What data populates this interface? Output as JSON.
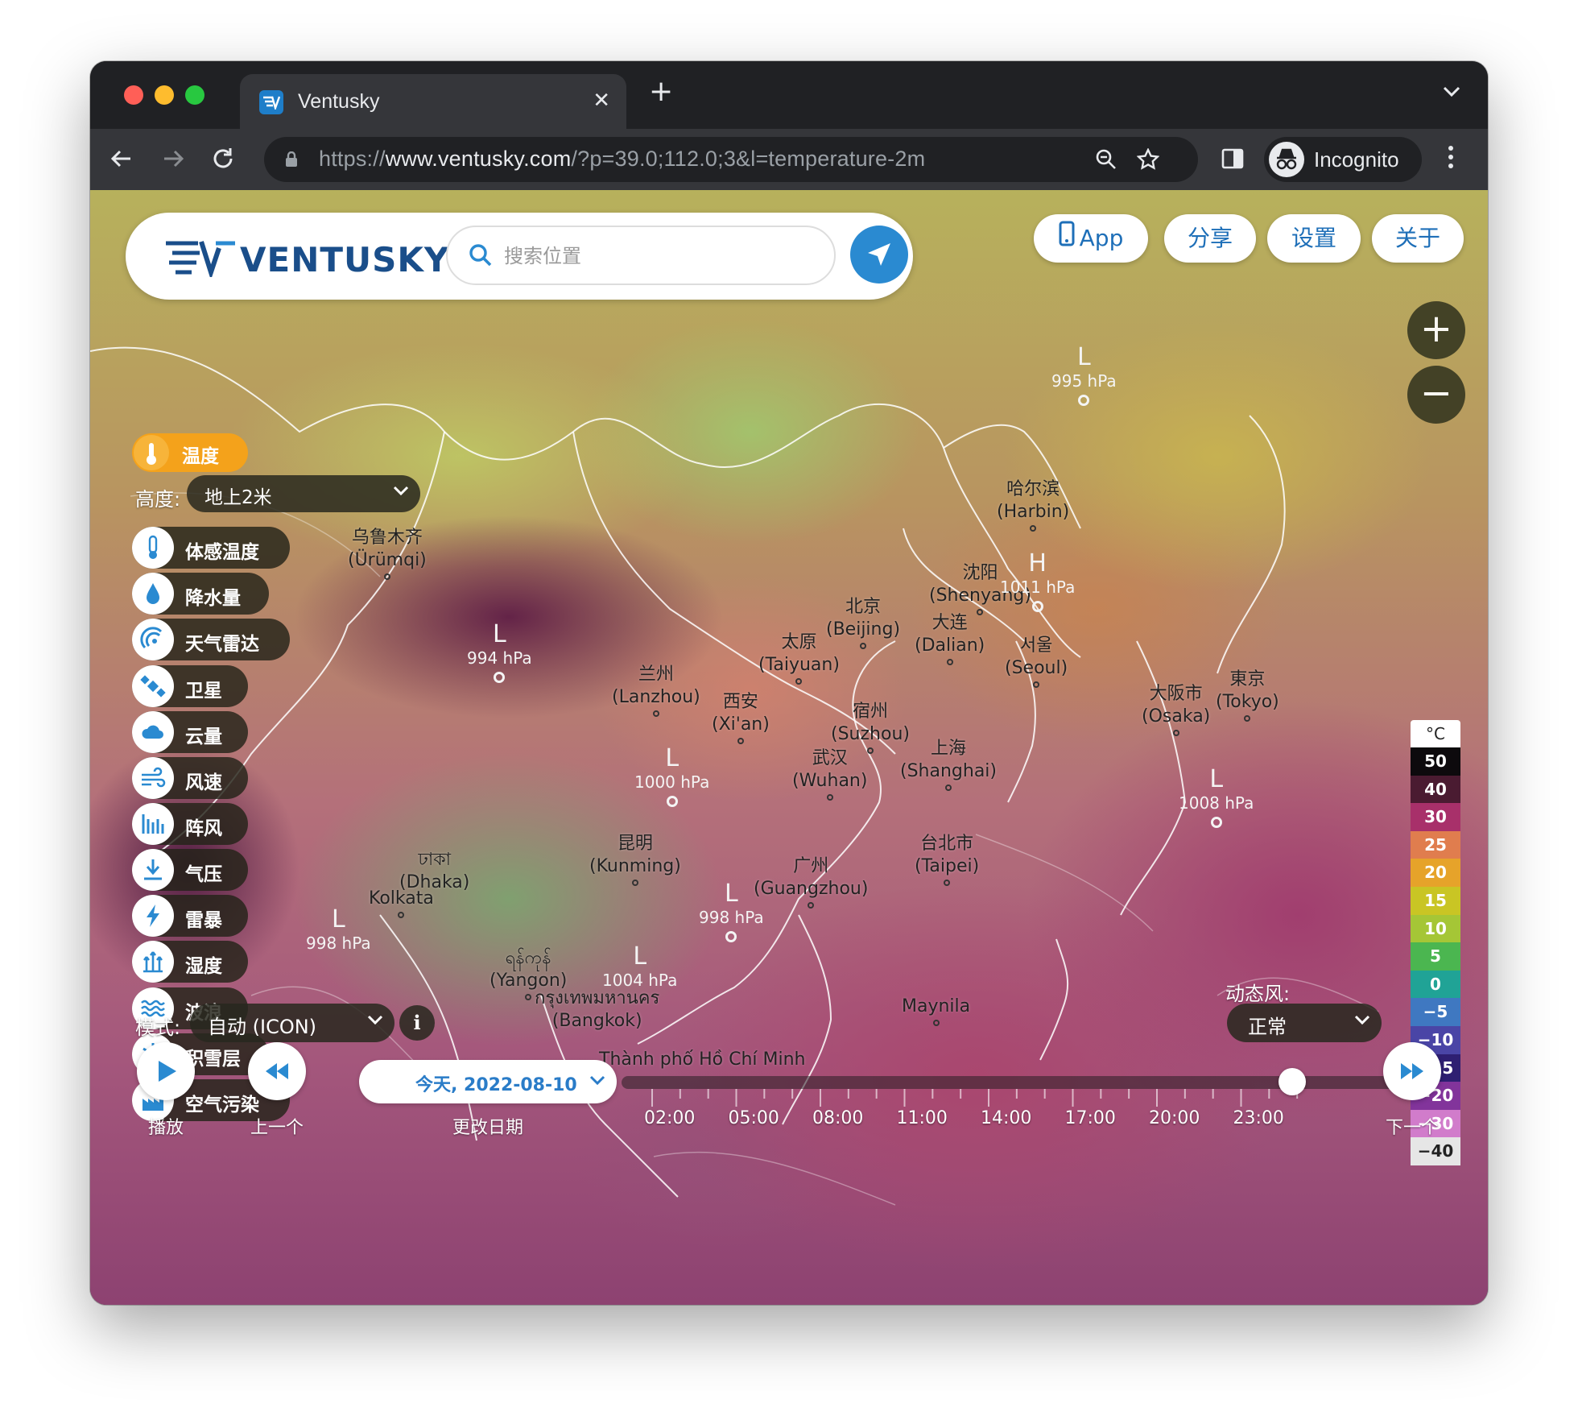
{
  "browser": {
    "tab_title": "Ventusky",
    "url_scheme": "https://",
    "url_host": "www.ventusky.com",
    "url_path": "/?p=39.0;112.0;3&l=temperature-2m",
    "profile_label": "Incognito"
  },
  "header": {
    "logo_text": "VENTUSKY",
    "search_placeholder": "搜索位置",
    "buttons": {
      "app": "App",
      "share": "分享",
      "settings": "设置",
      "about": "关于"
    }
  },
  "zoom": {
    "in": "+",
    "out": "−"
  },
  "layers": {
    "active": "温度",
    "altitude_label": "高度:",
    "altitude_value": "地上2米",
    "items": [
      {
        "label": "体感温度",
        "icon": "feels-like-thermometer-icon"
      },
      {
        "label": "降水量",
        "icon": "raindrop-icon"
      },
      {
        "label": "天气雷达",
        "icon": "radar-icon"
      },
      {
        "label": "卫星",
        "icon": "satellite-icon"
      },
      {
        "label": "云量",
        "icon": "cloud-icon"
      },
      {
        "label": "风速",
        "icon": "wind-icon"
      },
      {
        "label": "阵风",
        "icon": "gust-bars-icon"
      },
      {
        "label": "气压",
        "icon": "pressure-arrow-icon"
      },
      {
        "label": "雷暴",
        "icon": "lightning-icon"
      },
      {
        "label": "湿度",
        "icon": "humidity-icon"
      },
      {
        "label": "波浪",
        "icon": "waves-icon"
      },
      {
        "label": "积雪层",
        "icon": "snowflake-icon"
      },
      {
        "label": "空气污染",
        "icon": "factory-icon"
      }
    ],
    "mode_label": "模式:",
    "mode_value": "自动 (ICON)",
    "info": "i"
  },
  "wind": {
    "label": "动态风:",
    "value": "正常"
  },
  "legend": {
    "unit": "°C",
    "stops": [
      {
        "label": "50",
        "color": "#0d0a0d"
      },
      {
        "label": "40",
        "color": "#4a1b31"
      },
      {
        "label": "30",
        "color": "#a8306a"
      },
      {
        "label": "25",
        "color": "#e07d4e"
      },
      {
        "label": "20",
        "color": "#e6a32a"
      },
      {
        "label": "15",
        "color": "#c9c524"
      },
      {
        "label": "10",
        "color": "#a5c636"
      },
      {
        "label": "5",
        "color": "#4bb650"
      },
      {
        "label": "0",
        "color": "#20a396"
      },
      {
        "label": "−5",
        "color": "#3f78c1"
      },
      {
        "label": "−10",
        "color": "#4a45a6"
      },
      {
        "label": "−15",
        "color": "#2e1f72"
      },
      {
        "label": "−20",
        "color": "#82349b"
      },
      {
        "label": "−30",
        "color": "#d17ccb"
      },
      {
        "label": "−40",
        "color": "#e6e6e6"
      }
    ]
  },
  "cities": [
    {
      "name": "乌鲁木齐",
      "latin": "(Ürümqi)"
    },
    {
      "name": "哈尔滨",
      "latin": "(Harbin)"
    },
    {
      "name": "沈阳",
      "latin": "(Shenyang)"
    },
    {
      "name": "北京",
      "latin": "(Beijing)"
    },
    {
      "name": "大连",
      "latin": "(Dalian)"
    },
    {
      "name": "太原",
      "latin": "(Taiyuan)"
    },
    {
      "name": "서울",
      "latin": "(Seoul)"
    },
    {
      "name": "兰州",
      "latin": "(Lanzhou)"
    },
    {
      "name": "西安",
      "latin": "(Xi'an)"
    },
    {
      "name": "宿州",
      "latin": "(Suzhou)"
    },
    {
      "name": "大阪市",
      "latin": "(Osaka)"
    },
    {
      "name": "東京",
      "latin": "(Tokyo)"
    },
    {
      "name": "武汉",
      "latin": "(Wuhan)"
    },
    {
      "name": "上海",
      "latin": "(Shanghai)"
    },
    {
      "name": "昆明",
      "latin": "(Kunming)"
    },
    {
      "name": "台北市",
      "latin": "(Taipei)"
    },
    {
      "name": "广州",
      "latin": "(Guangzhou)"
    },
    {
      "name": "ঢাকা",
      "latin": "(Dhaka)"
    },
    {
      "name": "Kolkata",
      "latin": ""
    },
    {
      "name": "ရန်ကုန်",
      "latin": "(Yangon)"
    },
    {
      "name": "กรุงเทพมหานคร",
      "latin": "(Bangkok)"
    },
    {
      "name": "Maynila",
      "latin": ""
    },
    {
      "name": "Thành phố Hồ Chí Minh",
      "latin": ""
    }
  ],
  "pressure_systems": [
    {
      "type": "L",
      "value": "995 hPa"
    },
    {
      "type": "H",
      "value": "1011 hPa"
    },
    {
      "type": "L",
      "value": "994 hPa"
    },
    {
      "type": "L",
      "value": "1000 hPa"
    },
    {
      "type": "L",
      "value": "1008 hPa"
    },
    {
      "type": "L",
      "value": "998 hPa"
    },
    {
      "type": "L",
      "value": "998 hPa"
    },
    {
      "type": "L",
      "value": "1004 hPa"
    }
  ],
  "timeline": {
    "play_label": "播放",
    "prev_label": "上一个",
    "date_value": "今天, 2022-08-10",
    "change_date_label": "更改日期",
    "next_label": "下一个",
    "times": [
      "02:00",
      "05:00",
      "08:00",
      "11:00",
      "14:00",
      "17:00",
      "20:00",
      "23:00"
    ],
    "selected_time": "23:00"
  }
}
